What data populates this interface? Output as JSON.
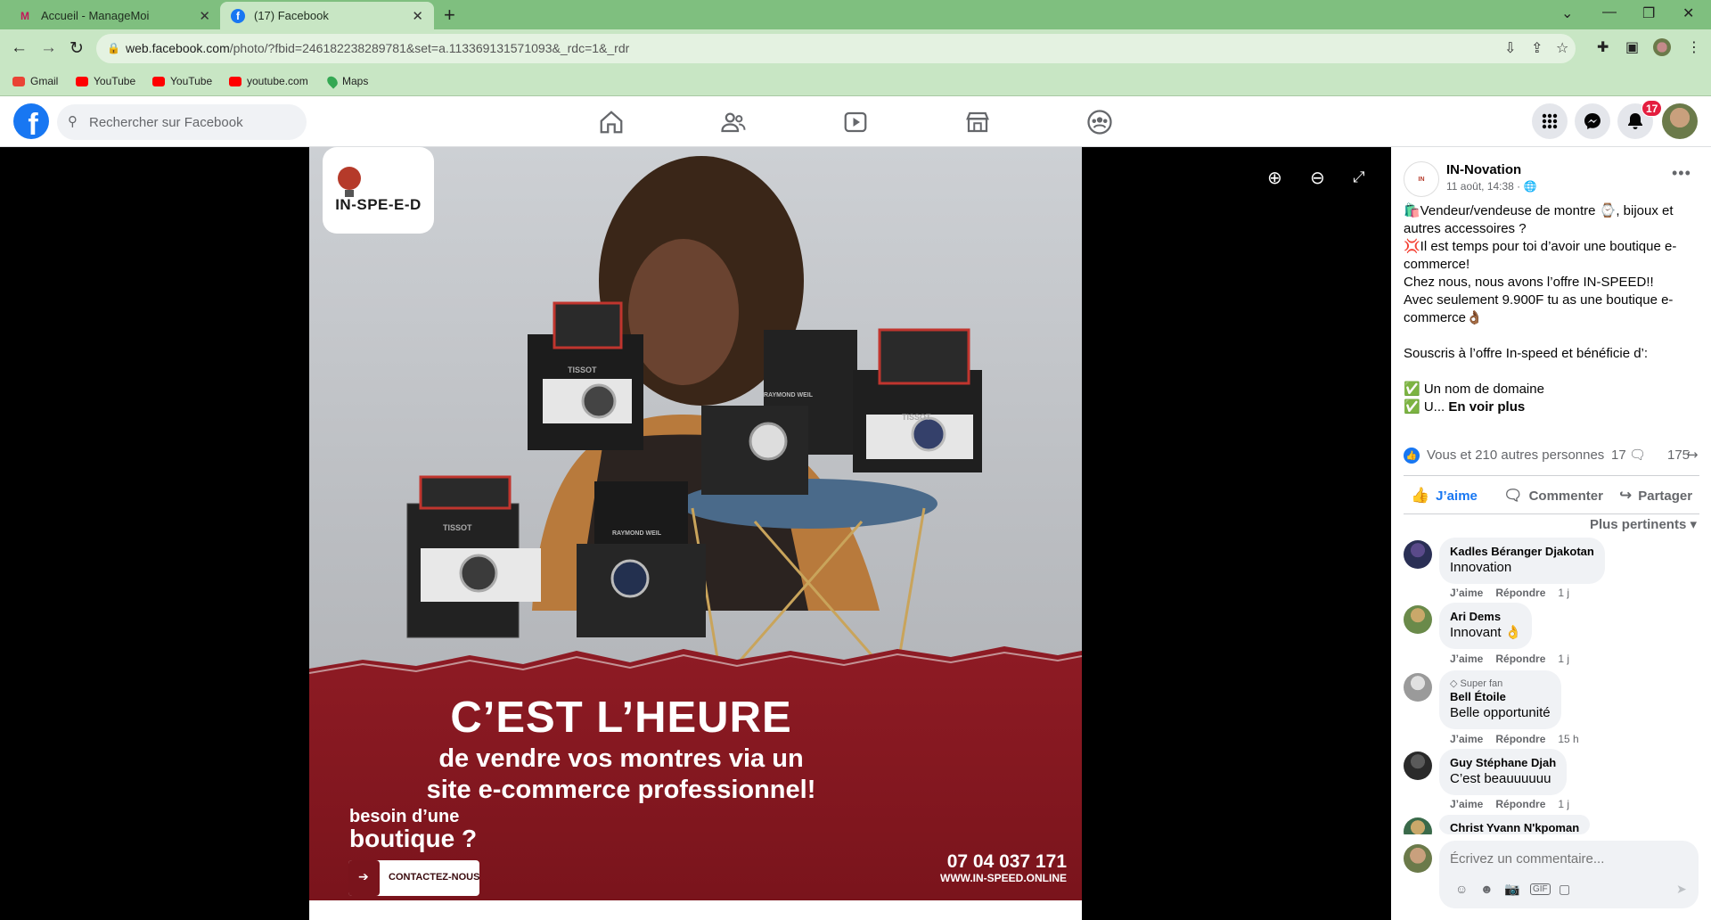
{
  "browser": {
    "tabs": [
      {
        "title": "Accueil - ManageMoi",
        "favicon": "M",
        "active": false
      },
      {
        "title": "(17) Facebook",
        "favicon": "f",
        "active": true
      }
    ],
    "new_tab": "+",
    "url_host": "web.facebook.com",
    "url_path": "/photo/?fbid=246182238289781&set=a.113369131571093&_rdc=1&_rdr",
    "bookmarks": [
      {
        "label": "Gmail",
        "color": "#ea4335"
      },
      {
        "label": "YouTube",
        "color": "#ff0000"
      },
      {
        "label": "YouTube",
        "color": "#ff0000"
      },
      {
        "label": "youtube.com",
        "color": "#ff0000"
      },
      {
        "label": "Maps",
        "color": "#34a853"
      }
    ]
  },
  "facebook": {
    "search_placeholder": "Rechercher sur Facebook",
    "notification_count": "17",
    "brand_color": "#1877f2"
  },
  "photo": {
    "logo_text": "IN-SPE-E-D",
    "headline": "C’EST L’HEURE",
    "subline_1": "de vendre vos montres via un",
    "subline_2": "site e-commerce professionnel!",
    "besoin_1": "besoin d’une",
    "besoin_2": "boutique ?",
    "cta": "CONTACTEZ-NOUS",
    "phone": "07 04 037 171",
    "website": "WWW.IN-SPEED.ONLINE",
    "watch_brands": [
      "TISSOT",
      "RAYMOND WEIL",
      "TISSOT",
      "RAYMOND WEIL",
      "TISSOT"
    ]
  },
  "post": {
    "page_name": "IN-Novation",
    "date": "11 août, 14:38 ·",
    "lines": [
      "🛍️Vendeur/vendeuse de montre ⌚, bijoux et autres accessoires ?",
      "💢Il est temps pour toi d’avoir une boutique e-commerce!",
      "Chez nous, nous avons l’offre IN-SPEED!!",
      "Avec seulement 9.900F tu as une boutique e-commerce👌🏾",
      "",
      "Souscris à l’offre In-speed et bénéficie d’:",
      "",
      "✅ Un nom de domaine"
    ],
    "last_line": "✅ U... ",
    "see_more": "En voir plus",
    "reactions": "Vous et 210 autres personnes",
    "comments_count": "17",
    "shares_count": "175",
    "like_label": "J’aime",
    "comment_label": "Commenter",
    "share_label": "Partager",
    "sort_label": "Plus pertinents"
  },
  "comments": [
    {
      "name": "Kadles Béranger Djakotan",
      "text": "Innovation",
      "time": "1 j",
      "badge": ""
    },
    {
      "name": "Ari Dems",
      "text": "Innovant 👌",
      "time": "1 j",
      "badge": ""
    },
    {
      "name": "Bell Étoile",
      "text": "Belle opportunité",
      "time": "15 h",
      "badge": "Super fan"
    },
    {
      "name": "Guy Stéphane Djah",
      "text": "C’est beauuuuuu",
      "time": "1 j",
      "badge": ""
    },
    {
      "name": "Christ Yvann N'kpoman",
      "text": "",
      "time": "",
      "badge": ""
    }
  ],
  "comment_actions": {
    "like": "J’aime",
    "reply": "Répondre"
  },
  "composer_placeholder": "Écrivez un commentaire..."
}
